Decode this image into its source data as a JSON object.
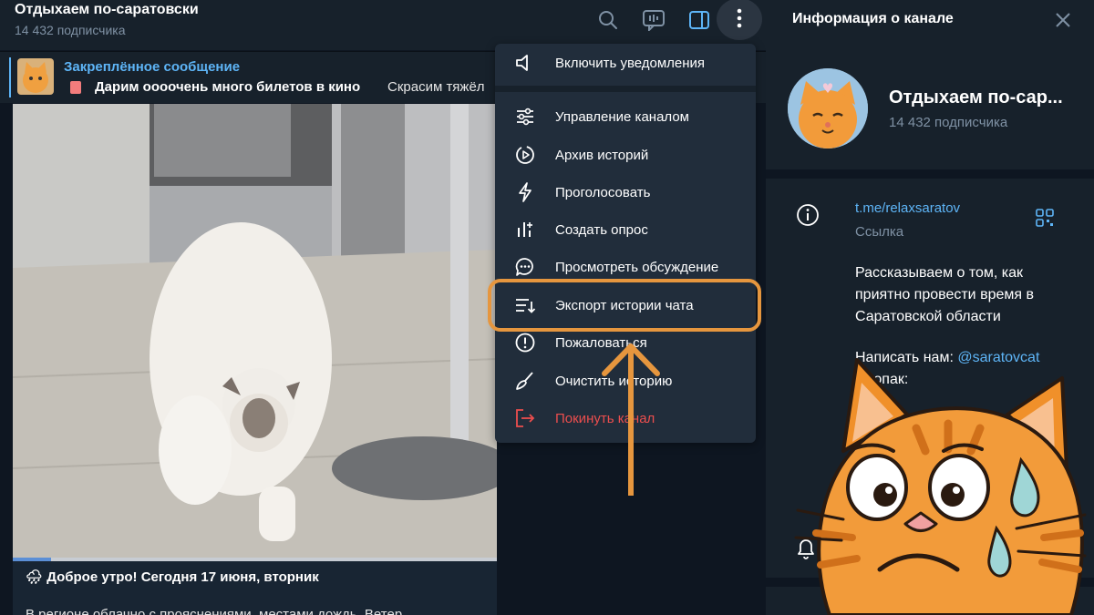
{
  "header": {
    "title": "Отдыхаем по-саратовски",
    "subscribers": "14 432 подписчика"
  },
  "pinned": {
    "title": "Закреплённое сообщение",
    "text": "Дарим оооочень много билетов в кино",
    "text_more": "Скрасим тяжёл"
  },
  "post": {
    "caption": "Доброе утро! Сегодня 17 июня, вторник",
    "body_fragment": "В регионе облачно с прояснениями, местами дождь. Ветер",
    "video_progress": 0.08
  },
  "menu": {
    "items": [
      {
        "label": "Включить уведомления",
        "icon": "speaker-icon"
      },
      {
        "label": "Управление каналом",
        "icon": "sliders-icon"
      },
      {
        "label": "Архив историй",
        "icon": "story-archive-icon"
      },
      {
        "label": "Проголосовать",
        "icon": "lightning-icon"
      },
      {
        "label": "Создать опрос",
        "icon": "poll-icon"
      },
      {
        "label": "Просмотреть обсуждение",
        "icon": "discussion-icon"
      },
      {
        "label": "Экспорт истории чата",
        "icon": "export-icon"
      },
      {
        "label": "Пожаловаться",
        "icon": "report-icon"
      },
      {
        "label": "Очистить историю",
        "icon": "broom-icon"
      },
      {
        "label": "Покинуть канал",
        "icon": "leave-icon"
      }
    ]
  },
  "info": {
    "title": "Информация о канале",
    "name": "Отдыхаем по-сар...",
    "subscribers": "14 432 подписчика",
    "link": "t.me/relaxsaratov",
    "link_label": "Ссылка",
    "description": "Рассказываем о том, как приятно провести время в Саратовской области",
    "write_prefix": "Написать нам:",
    "write_handle": "@saratovcat",
    "write2": "Пропак:"
  },
  "colors": {
    "accent": "#5eb5f7",
    "danger": "#ec4e4e",
    "highlight": "#e6963e"
  }
}
